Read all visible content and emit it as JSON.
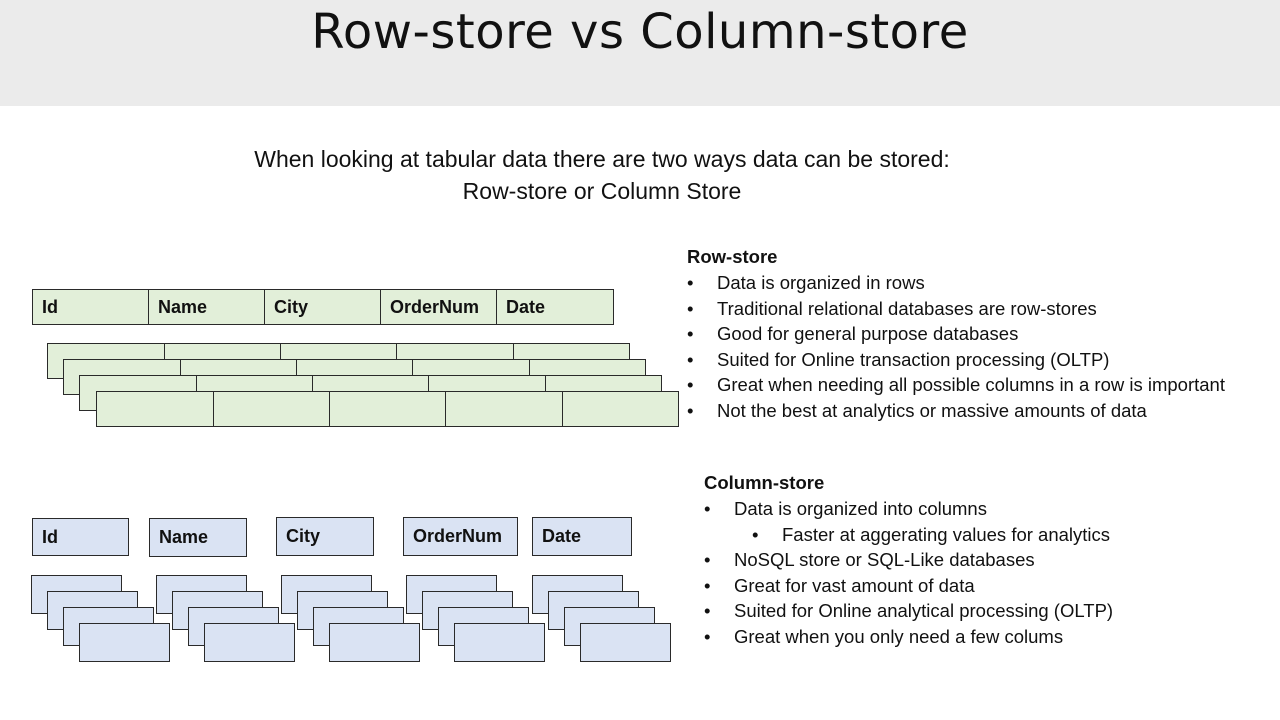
{
  "title": "Row-store vs Column-store",
  "intro": {
    "line1": "When looking at tabular data there are two ways data can be stored:",
    "line2": "Row-store or Column Store"
  },
  "columns": [
    "Id",
    "Name",
    "City",
    "OrderNum",
    "Date"
  ],
  "row_store": {
    "heading": "Row-store",
    "bullets": [
      "Data is organized in rows",
      "Traditional relational databases are row-stores",
      "Good for general purpose databases",
      "Suited for Online transaction processing (OLTP)",
      "Great when needing all possible columns in a row is important",
      "Not the best at analytics or massive amounts of data"
    ]
  },
  "column_store": {
    "heading": "Column-store",
    "bullets": [
      {
        "text": "Data is organized into columns",
        "level": 1
      },
      {
        "text": "Faster at aggerating values for analytics",
        "level": 2
      },
      {
        "text": "NoSQL store or SQL-Like databases",
        "level": 1
      },
      {
        "text": "Great for vast amount of data",
        "level": 1
      },
      {
        "text": "Suited for Online analytical processing (OLTP)",
        "level": 1
      },
      {
        "text": "Great when you only need a few colums",
        "level": 1
      }
    ]
  },
  "bullet_glyph": "•",
  "colors": {
    "row_fill": "#e2efd9",
    "column_fill": "#dae3f3",
    "header_band": "#ebebeb",
    "border": "#2a2a2a"
  }
}
